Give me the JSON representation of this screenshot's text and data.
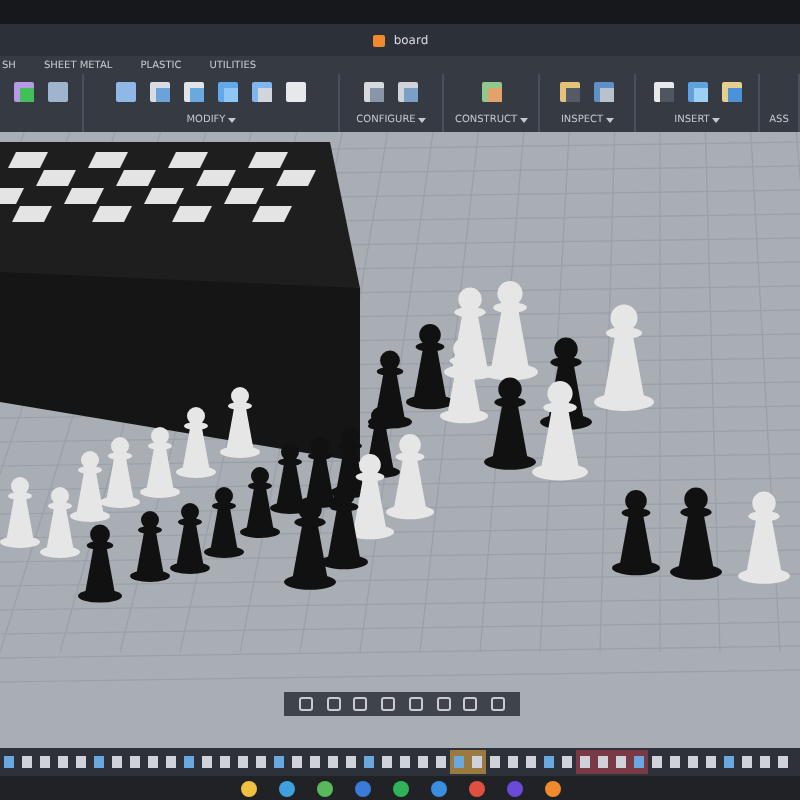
{
  "window": {
    "title": "board"
  },
  "tabs": [
    {
      "label": "SH"
    },
    {
      "label": "SHEET METAL"
    },
    {
      "label": "PLASTIC"
    },
    {
      "label": "UTILITIES"
    }
  ],
  "tool_groups": [
    {
      "dropdown": false
    },
    {
      "label": "MODIFY",
      "dropdown": true
    },
    {
      "label": "CONFIGURE",
      "dropdown": true
    },
    {
      "label": "CONSTRUCT",
      "dropdown": true
    },
    {
      "label": "INSPECT",
      "dropdown": true
    },
    {
      "label": "INSERT",
      "dropdown": true
    },
    {
      "label": "ASS",
      "dropdown": false
    }
  ]
}
